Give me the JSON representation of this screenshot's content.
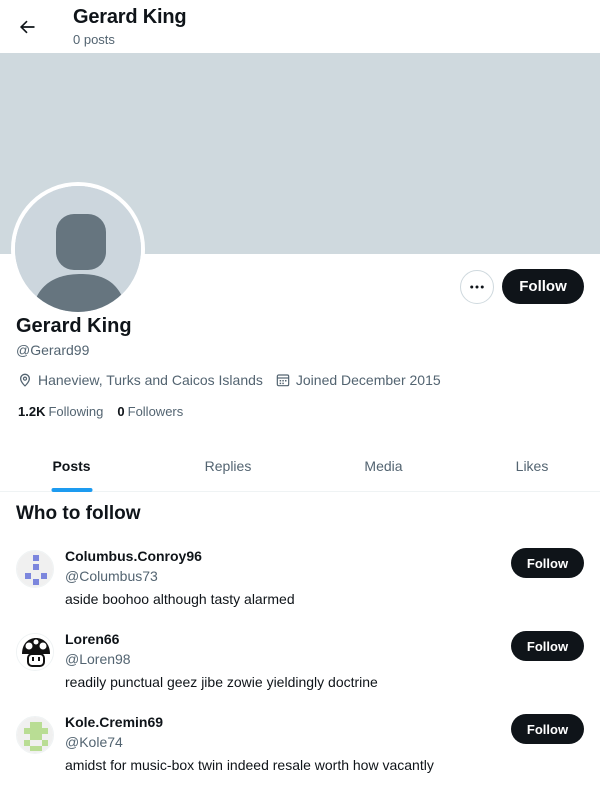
{
  "header": {
    "title": "Gerard King",
    "subtitle": "0 posts"
  },
  "profile": {
    "name": "Gerard King",
    "handle": "@Gerard99",
    "follow_label": "Follow",
    "location": "Haneview, Turks and Caicos Islands",
    "joined": "Joined December 2015",
    "following_count": "1.2K",
    "following_label": "Following",
    "followers_count": "0",
    "followers_label": "Followers"
  },
  "tabs": [
    {
      "label": "Posts",
      "active": true
    },
    {
      "label": "Replies",
      "active": false
    },
    {
      "label": "Media",
      "active": false
    },
    {
      "label": "Likes",
      "active": false
    }
  ],
  "who_to_follow": {
    "title": "Who to follow",
    "users": [
      {
        "name": "Columbus.Conroy96",
        "handle": "@Columbus73",
        "bio": "aside boohoo although tasty alarmed",
        "follow_label": "Follow"
      },
      {
        "name": "Loren66",
        "handle": "@Loren98",
        "bio": "readily punctual geez jibe zowie yieldingly doctrine",
        "follow_label": "Follow"
      },
      {
        "name": "Kole.Cremin69",
        "handle": "@Kole74",
        "bio": "amidst for music-box twin indeed resale worth how vacantly",
        "follow_label": "Follow"
      }
    ]
  },
  "colors": {
    "accent": "#1d9bf0",
    "text": "#0f1419",
    "secondary": "#536471",
    "banner": "#cfd9de"
  }
}
